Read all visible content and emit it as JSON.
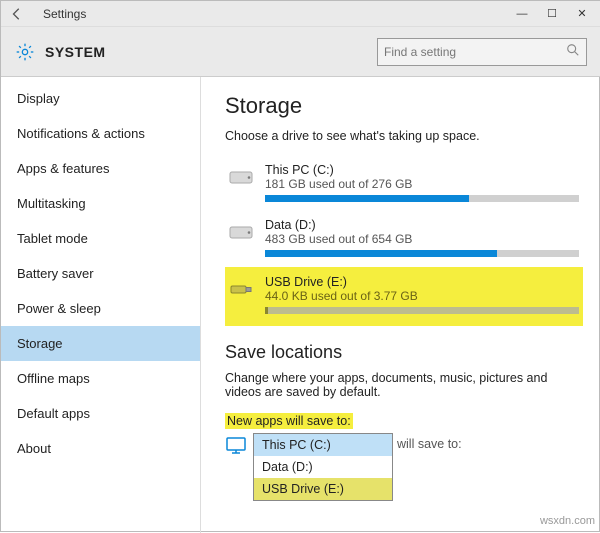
{
  "window": {
    "title": "Settings",
    "controls": {
      "min": "—",
      "max": "☐",
      "close": "✕"
    }
  },
  "header": {
    "heading": "SYSTEM",
    "search_placeholder": "Find a setting"
  },
  "sidebar": {
    "items": [
      {
        "label": "Display"
      },
      {
        "label": "Notifications & actions"
      },
      {
        "label": "Apps & features"
      },
      {
        "label": "Multitasking"
      },
      {
        "label": "Tablet mode"
      },
      {
        "label": "Battery saver"
      },
      {
        "label": "Power & sleep"
      },
      {
        "label": "Storage",
        "selected": true
      },
      {
        "label": "Offline maps"
      },
      {
        "label": "Default apps"
      },
      {
        "label": "About"
      }
    ]
  },
  "content": {
    "storage_title": "Storage",
    "storage_sub": "Choose a drive to see what's taking up space.",
    "drives": [
      {
        "name": "This PC (C:)",
        "stat": "181 GB used out of 276 GB",
        "fill_pct": 65
      },
      {
        "name": "Data (D:)",
        "stat": "483 GB used out of 654 GB",
        "fill_pct": 74
      },
      {
        "name": "USB Drive (E:)",
        "stat": "44.0 KB used out of 3.77 GB",
        "fill_pct": 1,
        "highlight": true
      }
    ],
    "save_title": "Save locations",
    "save_sub": "Change where your apps, documents, music, pictures and videos are saved by default.",
    "new_apps_label": "New apps will save to:",
    "dropdown": {
      "options": [
        {
          "label": "This PC (C:)",
          "selected": true
        },
        {
          "label": "Data (D:)"
        },
        {
          "label": "USB Drive (E:)",
          "highlight": true
        }
      ]
    },
    "trail_text": "will save to:"
  },
  "watermark": "wsxdn.com"
}
